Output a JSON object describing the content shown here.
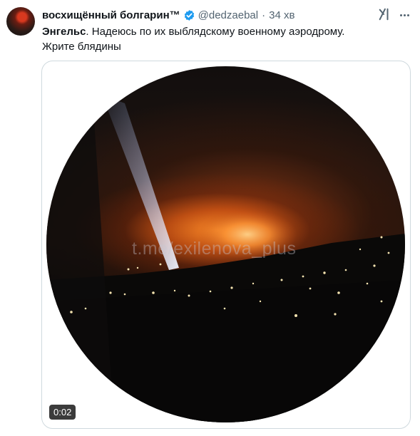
{
  "author": {
    "display_name": "восхищённый болгарин™",
    "handle": "@dedzaebal",
    "separator": "·",
    "time": "34 хв"
  },
  "tweet": {
    "place": "Энгельс",
    "line1_rest": ". Надеюсь по их выблядскому военному аэродрому.",
    "line2": "Жрите блядины"
  },
  "media": {
    "watermark": "t.me/exilenova_plus",
    "duration": "0:02"
  },
  "icons": {
    "avatar": "profile-photo",
    "verified": "verified-badge-icon",
    "grok": "grok-icon",
    "more": "more-options-icon"
  },
  "colors": {
    "verified": "#1d9bf0",
    "secondary_text": "#536471",
    "border": "#cfd9de"
  }
}
